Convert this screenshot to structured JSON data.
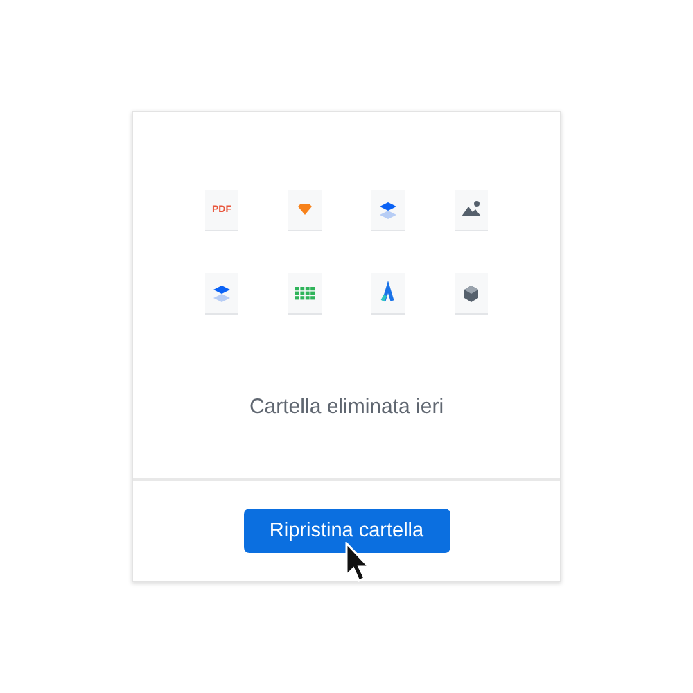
{
  "files": [
    {
      "kind": "pdf",
      "label": "PDF"
    },
    {
      "kind": "gem"
    },
    {
      "kind": "layers"
    },
    {
      "kind": "image"
    },
    {
      "kind": "layers"
    },
    {
      "kind": "grid"
    },
    {
      "kind": "chevron"
    },
    {
      "kind": "cube"
    }
  ],
  "message": "Cartella eliminata ieri",
  "button": "Ripristina cartella"
}
